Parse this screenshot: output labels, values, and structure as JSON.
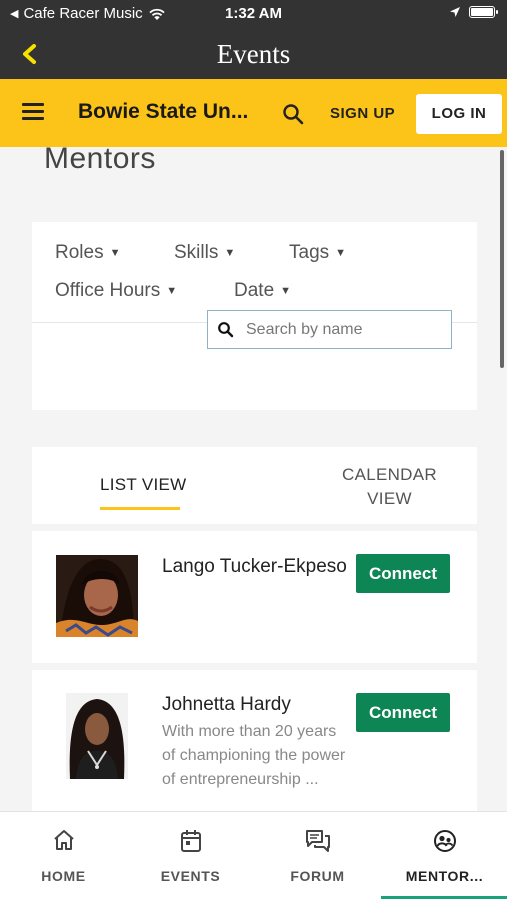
{
  "status_bar": {
    "carrier": "Cafe Racer Music",
    "time": "1:32 AM"
  },
  "nav_bar": {
    "title": "Events"
  },
  "header": {
    "site_title": "Bowie State Un...",
    "signup_label": "SIGN UP",
    "login_label": "LOG IN"
  },
  "page": {
    "heading": "Mentors"
  },
  "filters": {
    "roles": "Roles",
    "skills": "Skills",
    "tags": "Tags",
    "office_hours": "Office Hours",
    "date": "Date",
    "search_placeholder": "Search by name"
  },
  "view_tabs": {
    "list": "LIST VIEW",
    "calendar_line1": "CALENDAR",
    "calendar_line2": "VIEW"
  },
  "mentors": [
    {
      "name": "Lango Tucker-Ekpeso",
      "description": "",
      "connect_label": "Connect"
    },
    {
      "name": "Johnetta Hardy",
      "description_lines": [
        "With more than 20 years",
        "of championing the power",
        "of entrepreneurship ..."
      ],
      "connect_label": "Connect"
    }
  ],
  "tab_bar": {
    "items": [
      {
        "label": "HOME",
        "icon": "home-icon"
      },
      {
        "label": "EVENTS",
        "icon": "calendar-icon"
      },
      {
        "label": "FORUM",
        "icon": "forum-icon"
      },
      {
        "label": "MENTOR...",
        "icon": "mentor-icon"
      }
    ],
    "active_index": 3
  },
  "colors": {
    "header_yellow": "#fcc418",
    "dark_bar": "#333333",
    "connect_green": "#0e8554",
    "active_tab_line": "#1aa37a"
  }
}
